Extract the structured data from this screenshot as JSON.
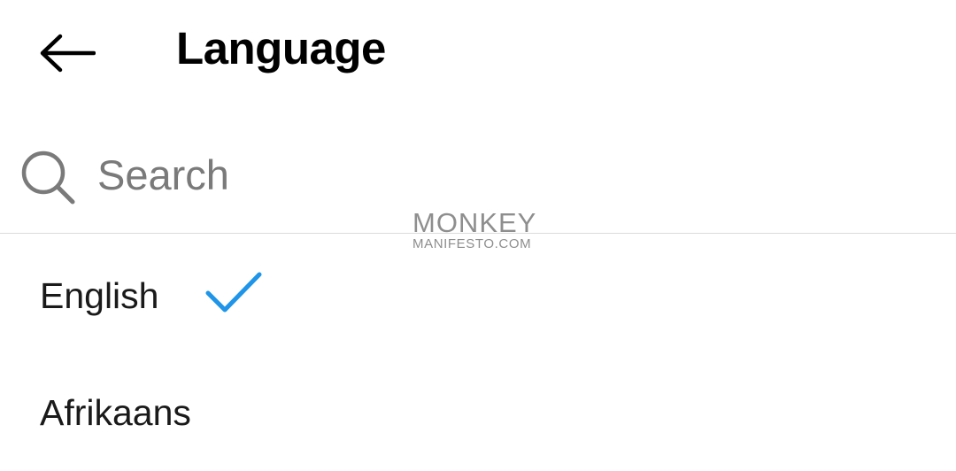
{
  "header": {
    "back_icon": "arrow-left-icon",
    "title": "Language"
  },
  "search": {
    "icon": "search-icon",
    "placeholder": "Search",
    "value": ""
  },
  "watermark": {
    "line1": "MONKEY",
    "line2": "MANIFESTO.COM"
  },
  "languages": [
    {
      "label": "English",
      "selected": true
    },
    {
      "label": "Afrikaans",
      "selected": false
    }
  ],
  "colors": {
    "accent": "#1e95e8",
    "placeholder": "#7a7a7a",
    "divider": "#dcdcdc"
  }
}
